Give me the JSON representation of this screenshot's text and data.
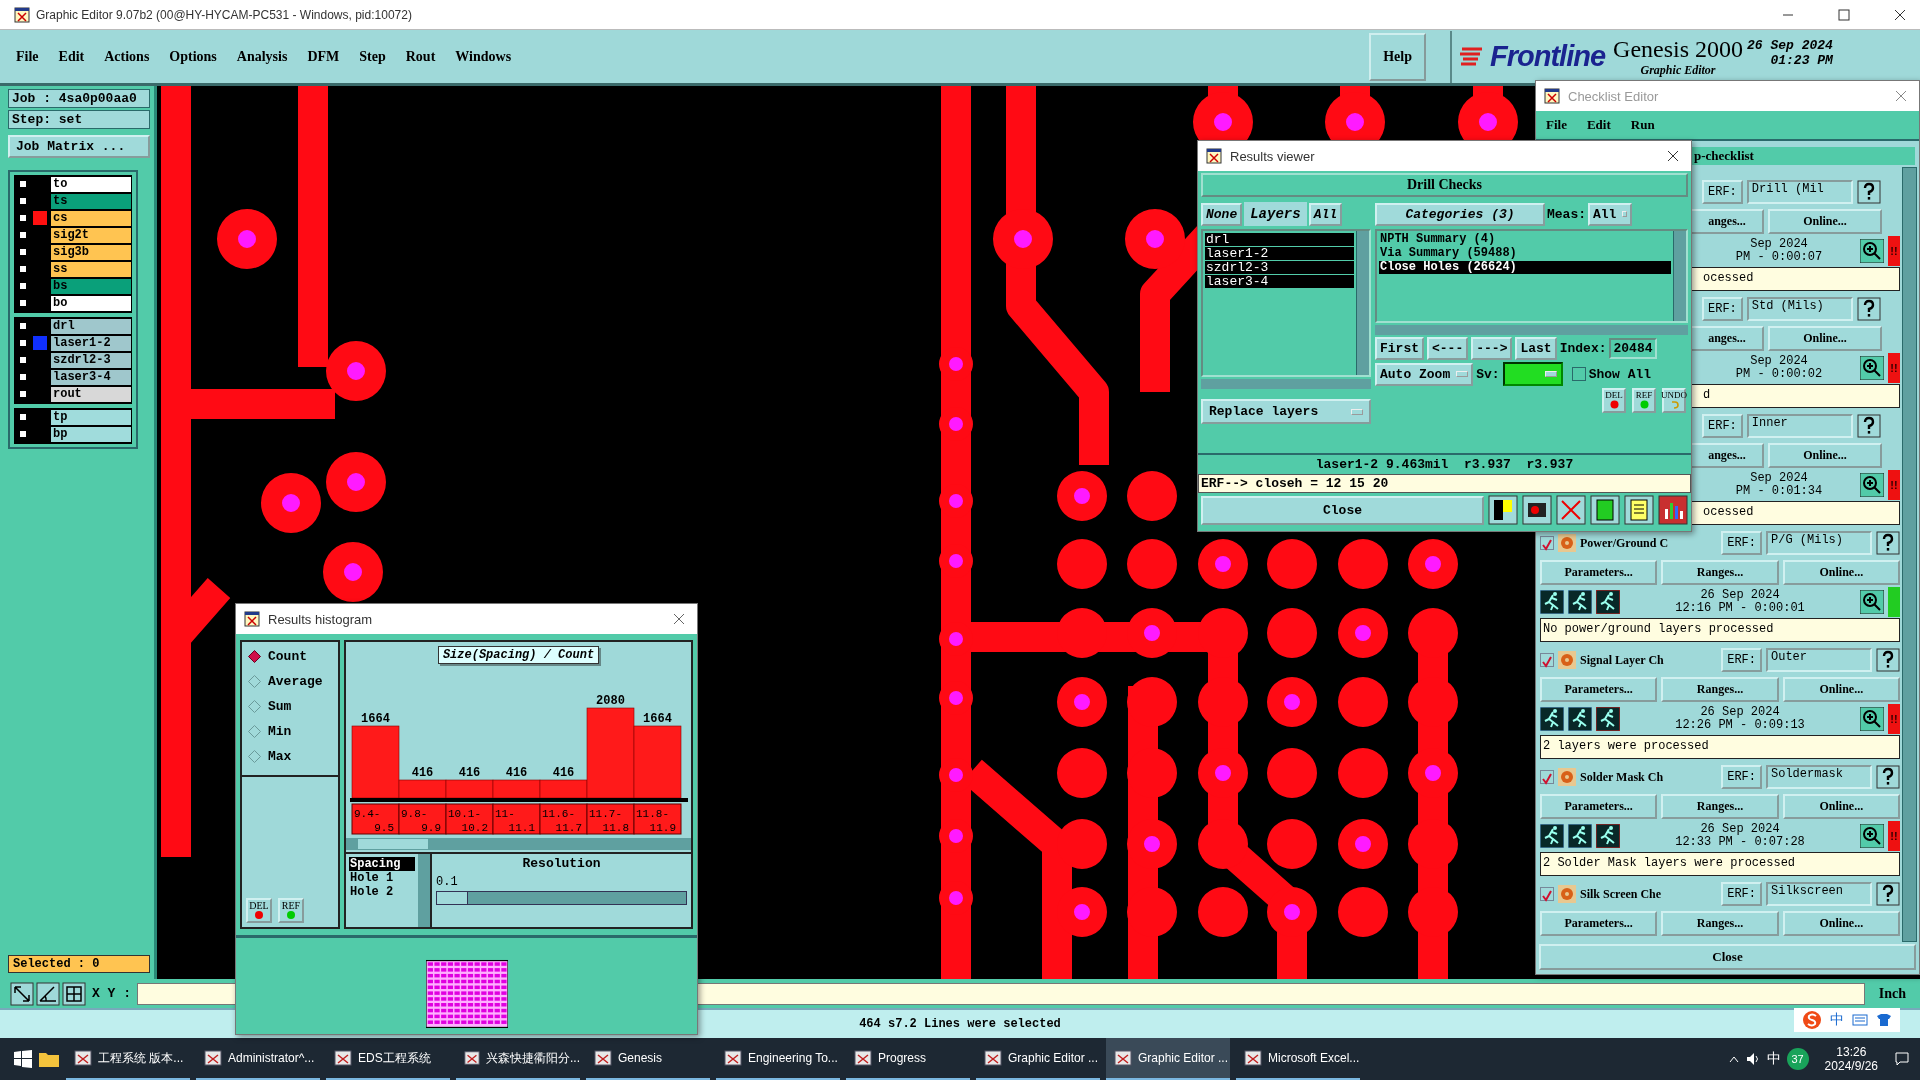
{
  "window": {
    "title": "Graphic Editor 9.07b2 (00@HY-HYCAM-PC531 - Windows, pid:10072)"
  },
  "menu": [
    "File",
    "Edit",
    "Actions",
    "Options",
    "Analysis",
    "DFM",
    "Step",
    "Rout",
    "Windows"
  ],
  "help": "Help",
  "brand": {
    "logo": "Frontline",
    "product": "Genesis 2000",
    "subtitle": "Graphic Editor",
    "date": "26 Sep 2024",
    "time": "01:23 PM"
  },
  "job": {
    "job": "Job : 4sa0p00aa0",
    "step": "Step: set",
    "matrix_button": "Job Matrix ..."
  },
  "layer_groups": [
    [
      {
        "name": "to",
        "color": "#ffffff",
        "checked": false
      },
      {
        "name": "ts",
        "color": "#0aa07a",
        "checked": false
      },
      {
        "name": "cs",
        "color": "#ffc451",
        "swatch": {
          "color": "#ff1010"
        },
        "checked": false
      },
      {
        "name": "sig2t",
        "color": "#ffc451",
        "checked": false
      },
      {
        "name": "sig3b",
        "color": "#ffc451",
        "checked": false
      },
      {
        "name": "ss",
        "color": "#ffc451",
        "checked": false
      },
      {
        "name": "bs",
        "color": "#0aa07a",
        "checked": false
      },
      {
        "name": "bo",
        "color": "#ffffff",
        "checked": false
      }
    ],
    [
      {
        "name": "drl",
        "color": "#9fc7cc",
        "checked": false
      },
      {
        "name": "laser1-2",
        "color": "#9fc7cc",
        "swatch": {
          "color": "#1030ff"
        },
        "checked": false
      },
      {
        "name": "szdrl2-3",
        "color": "#9fc7cc",
        "checked": false
      },
      {
        "name": "laser3-4",
        "color": "#9fc7cc",
        "checked": false
      },
      {
        "name": "rout",
        "color": "#d8d8d8",
        "checked": false
      }
    ],
    [
      {
        "name": "tp",
        "color": "#a0dcdc",
        "checked": false
      },
      {
        "name": "bp",
        "color": "#a0dcdc",
        "checked": false
      }
    ]
  ],
  "selected_count": "Selected : 0",
  "xy_label": "X Y :",
  "units": "Inch",
  "status_bar": "464 s7.2 Lines were selected",
  "histogram": {
    "title": "Results histogram",
    "modes": [
      {
        "label": "Count",
        "selected": true
      },
      {
        "label": "Average",
        "selected": false
      },
      {
        "label": "Sum",
        "selected": false
      },
      {
        "label": "Min",
        "selected": false
      },
      {
        "label": "Max",
        "selected": false
      }
    ],
    "del": "DEL",
    "ref": "REF",
    "chart_data": {
      "type": "bar",
      "title": "Size(Spacing) / Count",
      "categories": [
        "9.4-9.5",
        "9.8-9.9",
        "10.1-10.2",
        "11-11.1",
        "11.6-11.7",
        "11.7-11.8",
        "11.8-11.9"
      ],
      "values": [
        1664,
        416,
        416,
        416,
        416,
        2080,
        1664
      ],
      "data_labels": true
    },
    "fields": [
      {
        "label": "Spacing",
        "selected": true
      },
      {
        "label": "Hole 1",
        "selected": false
      },
      {
        "label": "Hole 2",
        "selected": false
      }
    ],
    "resolution": {
      "label": "Resolution",
      "value": "0.1",
      "level": 0.08
    }
  },
  "viewer": {
    "title": "Results viewer",
    "heading": "Drill Checks",
    "none_button": "None",
    "layers_label": "Layers",
    "all_button": "All",
    "layers": [
      {
        "label": "drl",
        "selected": true
      },
      {
        "label": "laser1-2",
        "selected": true
      },
      {
        "label": "szdrl2-3",
        "selected": true
      },
      {
        "label": "laser3-4",
        "selected": true
      }
    ],
    "categories_button": "Categories (3)",
    "meas_label": "Meas:",
    "meas_value": "All",
    "categories": [
      {
        "label": "NPTH Summary (4)",
        "selected": false
      },
      {
        "label": "Via Summary (59488)",
        "selected": false
      },
      {
        "label": "Close Holes (26624)",
        "selected": true
      }
    ],
    "nav": [
      "First",
      "<---",
      "--->",
      "Last"
    ],
    "index_label": "Index:",
    "index": "20484",
    "zoom": "Auto Zoom",
    "sv_label": "Sv:",
    "severity": {
      "color": "#22dd22"
    },
    "show_all": {
      "label": "Show All",
      "checked": false
    },
    "tools": [
      "DEL",
      "REF",
      "UNDO"
    ],
    "replace": "Replace layers",
    "info": "laser1-2 9.463mil  r3.937  r3.937",
    "erf": "ERF--> closeh = 12 15 20",
    "close": "Close"
  },
  "checklist": {
    "title": "Checklist Editor",
    "menu": [
      "File",
      "Edit",
      "Run"
    ],
    "name": "p-checklist",
    "close": "Close",
    "checks": [
      {
        "kind": "covered",
        "erf_label": "ERF:",
        "erf": "Drill (Mil",
        "ranges": "anges...",
        "online": "Online...",
        "date": "Sep 2024",
        "time": "PM - 0:00:07",
        "color": "#ee1111",
        "flag": "!!",
        "message": "ocessed"
      },
      {
        "kind": "covered",
        "erf_label": "ERF:",
        "erf": "Std (Mils)",
        "ranges": "anges...",
        "online": "Online...",
        "date": "Sep 2024",
        "time": "PM - 0:00:02",
        "color": "#ee1111",
        "flag": "!!",
        "message": "d"
      },
      {
        "kind": "covered",
        "erf_label": "ERF:",
        "erf": "Inner",
        "ranges": "anges...",
        "online": "Online...",
        "date": "Sep 2024",
        "time": "PM - 0:01:34",
        "color": "#ee1111",
        "flag": "!!",
        "message": "ocessed"
      },
      {
        "kind": "full",
        "checked": true,
        "name": "Power/Ground C",
        "erf_label": "ERF:",
        "erf": "P/G (Mils)",
        "parameters": "Parameters...",
        "ranges": "Ranges...",
        "online": "Online...",
        "date": "26 Sep 2024",
        "time": "12:16 PM - 0:00:01",
        "color": "#22cc22",
        "message": "No power/ground layers processed"
      },
      {
        "kind": "full",
        "checked": true,
        "name": "Signal Layer Ch",
        "erf_label": "ERF:",
        "erf": "Outer",
        "parameters": "Parameters...",
        "ranges": "Ranges...",
        "online": "Online...",
        "date": "26 Sep 2024",
        "time": "12:26 PM - 0:09:13",
        "color": "#ee1111",
        "flag": "!!",
        "message": "2 layers were processed"
      },
      {
        "kind": "full",
        "checked": true,
        "name": "Solder Mask Ch",
        "erf_label": "ERF:",
        "erf": "Soldermask",
        "parameters": "Parameters...",
        "ranges": "Ranges...",
        "online": "Online...",
        "date": "26 Sep 2024",
        "time": "12:33 PM - 0:07:28",
        "color": "#ee1111",
        "flag": "!!",
        "message": "2 Solder Mask layers were processed"
      },
      {
        "kind": "full",
        "checked": true,
        "name": "Silk Screen Che",
        "erf_label": "ERF:",
        "erf": "Silkscreen",
        "parameters": "Parameters...",
        "ranges": "Ranges...",
        "online": "Online..."
      }
    ]
  },
  "ime": "中",
  "taskbar": {
    "items": [
      {
        "label": "工程系统  版本...",
        "selected": false
      },
      {
        "label": "Administrator^...",
        "selected": false
      },
      {
        "label": "EDS工程系统",
        "selected": false
      },
      {
        "label": "兴森快捷衢阳分...",
        "selected": false
      },
      {
        "label": "Genesis",
        "selected": false
      },
      {
        "label": "Engineering To...",
        "selected": false
      },
      {
        "label": "Progress",
        "selected": false
      },
      {
        "label": "Graphic Editor ...",
        "selected": false
      },
      {
        "label": "Graphic Editor ...",
        "selected": true
      },
      {
        "label": "Microsoft Excel...",
        "selected": false
      }
    ],
    "ime": "中",
    "badge": "37",
    "time": "13:26",
    "date": "2024/9/26"
  }
}
